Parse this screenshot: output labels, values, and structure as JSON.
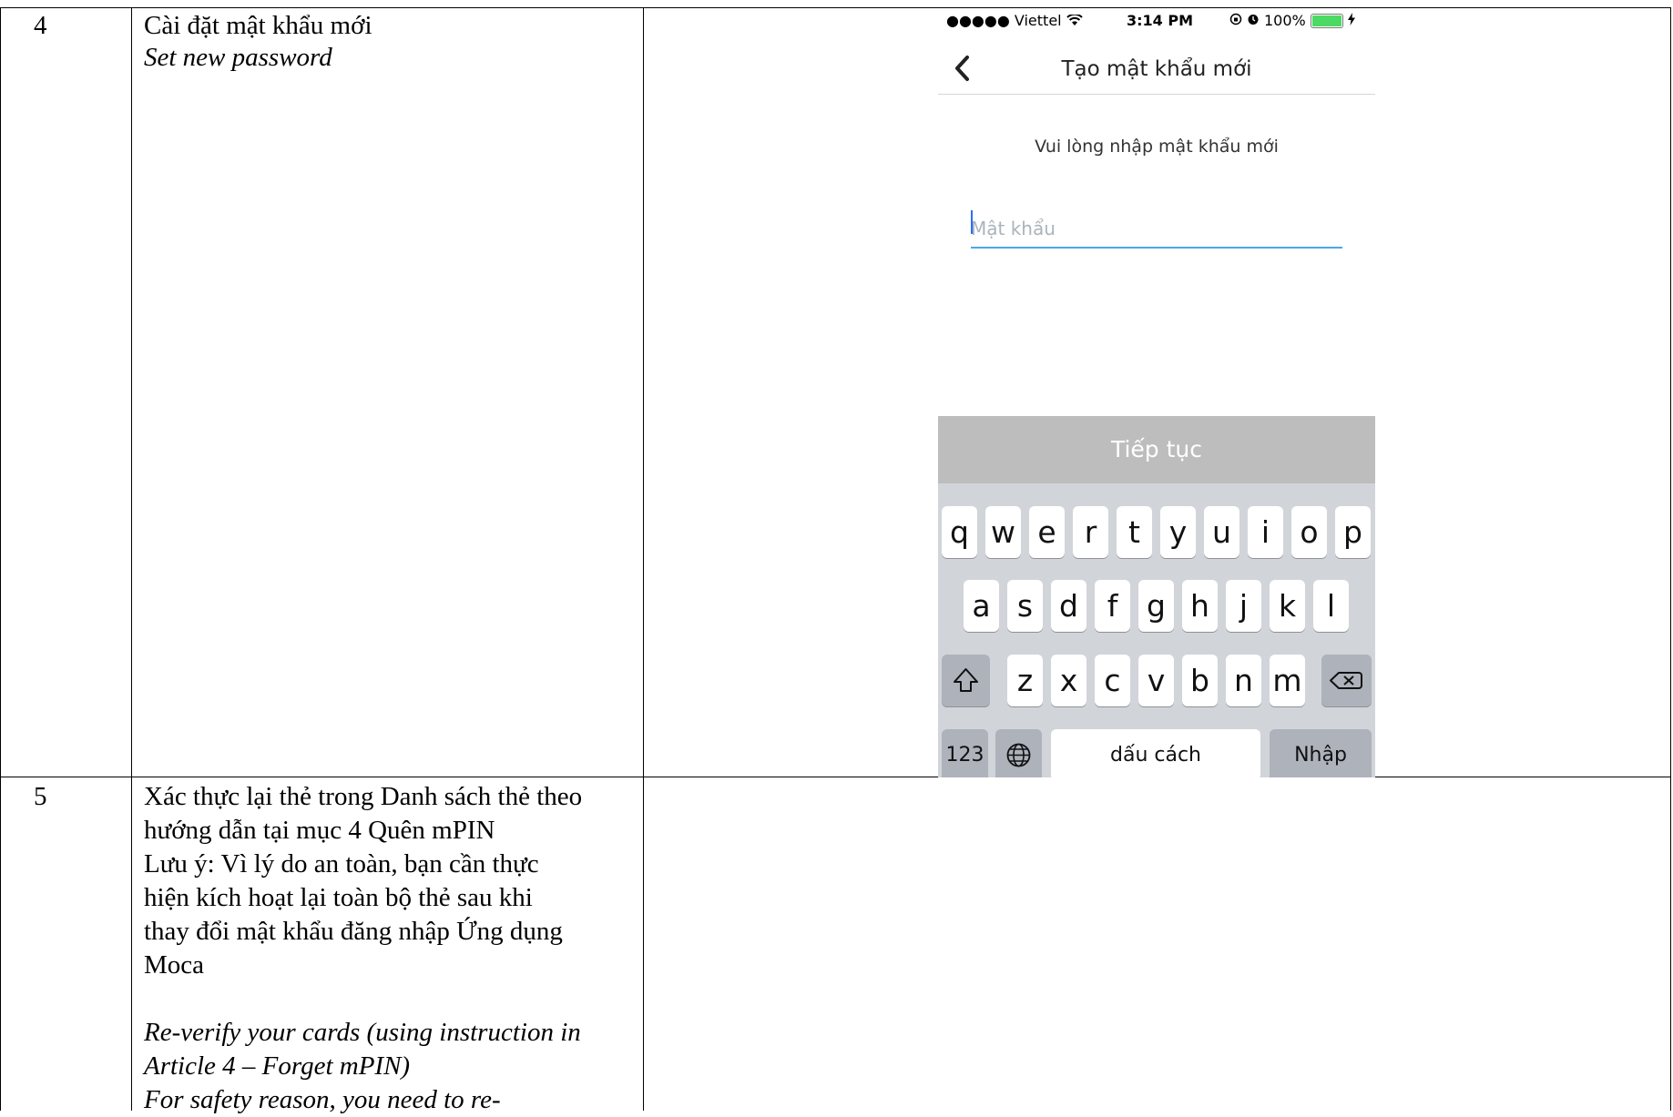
{
  "rows": [
    {
      "number": "4",
      "description_vi": "Cài đặt mật khẩu mới",
      "description_en": "Set new password"
    },
    {
      "number": "5",
      "description_lines": [
        "Xác thực lại thẻ trong Danh sách thẻ theo",
        "hướng dẫn tại mục 4 Quên mPIN",
        "Lưu ý: Vì lý do an toàn, bạn cần thực",
        "hiện kích hoạt lại toàn bộ thẻ sau khi",
        "thay đổi mật khẩu đăng nhập Ứng dụng",
        "Moca"
      ],
      "description_en_lines": [
        "Re-verify your cards (using instruction in",
        "Article 4 – Forget mPIN)",
        "For safety reason, you need to re-"
      ]
    }
  ],
  "phone": {
    "status": {
      "carrier": "●●●●● Viettel",
      "time": "3:14 PM",
      "battery": "100%",
      "battery_level": 1.0
    },
    "nav_title": "Tạo mật khẩu mới",
    "prompt": "Vui lòng nhập mật khẩu mới",
    "password_placeholder": "Mật khẩu",
    "password_value": "",
    "continue_label": "Tiếp tục",
    "keyboard": {
      "row1": [
        "q",
        "w",
        "e",
        "r",
        "t",
        "y",
        "u",
        "i",
        "o",
        "p"
      ],
      "row2": [
        "a",
        "s",
        "d",
        "f",
        "g",
        "h",
        "j",
        "k",
        "l"
      ],
      "row3": [
        "z",
        "x",
        "c",
        "v",
        "b",
        "n",
        "m"
      ],
      "numbers_label": "123",
      "space_label": "dấu cách",
      "return_label": "Nhập"
    }
  }
}
